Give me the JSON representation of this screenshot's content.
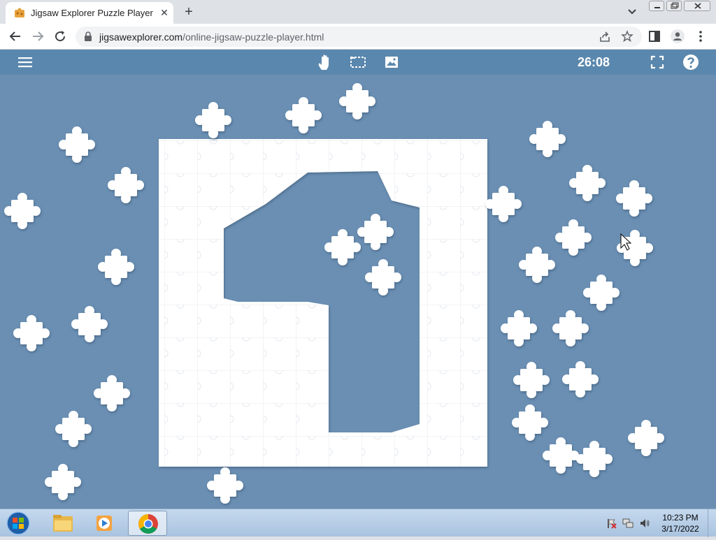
{
  "browser": {
    "tab_title": "Jigsaw Explorer Puzzle Player",
    "tab_close": "✕",
    "new_tab": "+",
    "url_domain": "jigsawexplorer.com",
    "url_path": "/online-jigsaw-puzzle-player.html"
  },
  "puzzle": {
    "timer": "26:08",
    "colors": {
      "bar": "#5a87ad",
      "board": "#6a8fb3",
      "piece": "#ffffff"
    }
  },
  "taskbar": {
    "time": "10:23 PM",
    "date": "3/17/2022"
  }
}
